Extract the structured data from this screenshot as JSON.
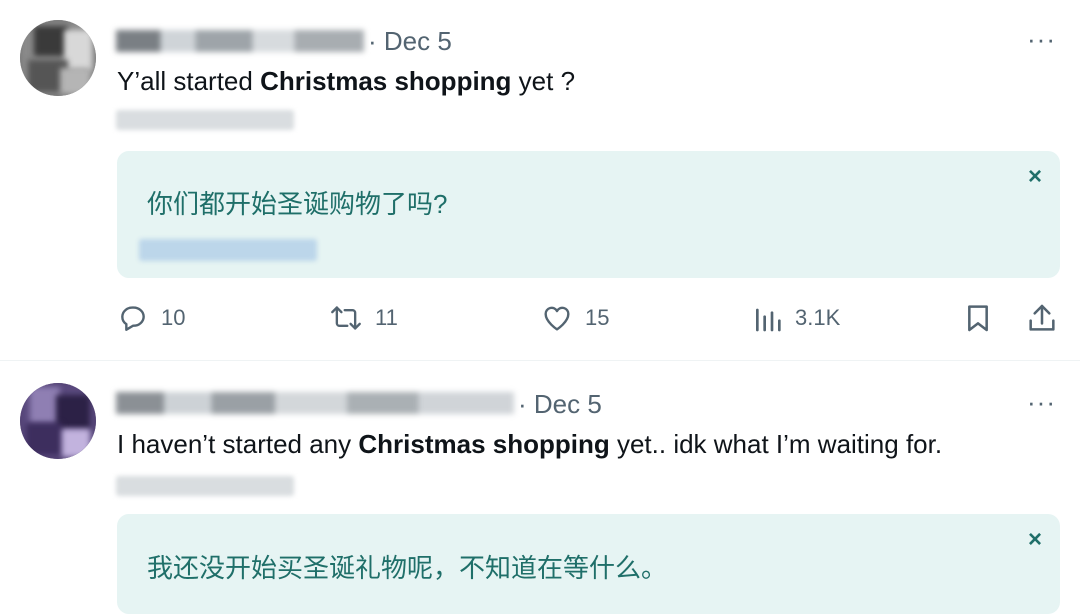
{
  "tweets": [
    {
      "date": "· Dec 5",
      "text_pre": "Y’all started ",
      "text_bold": "Christmas shopping",
      "text_post": " yet ?",
      "translation": "你们都开始圣诞购物了吗?",
      "close_label": "×",
      "more_label": "···",
      "stats": {
        "replies": "10",
        "retweets": "11",
        "likes": "15",
        "views": "3.1K"
      }
    },
    {
      "date": "· Dec 5",
      "text_pre": "I haven’t started any ",
      "text_bold": "Christmas shopping",
      "text_post": " yet.. idk what I’m waiting for.",
      "translation": "我还没开始买圣诞礼物呢，不知道在等什么。",
      "close_label": "×",
      "more_label": "···"
    }
  ],
  "icons": [
    "reply-icon",
    "retweet-icon",
    "like-icon",
    "views-icon",
    "bookmark-icon",
    "share-icon"
  ],
  "colors": {
    "text": "#0f1419",
    "muted": "#536471",
    "translation_bg": "#e6f4f3",
    "translation_text": "#1f6f69",
    "divider": "#eff3f4"
  }
}
